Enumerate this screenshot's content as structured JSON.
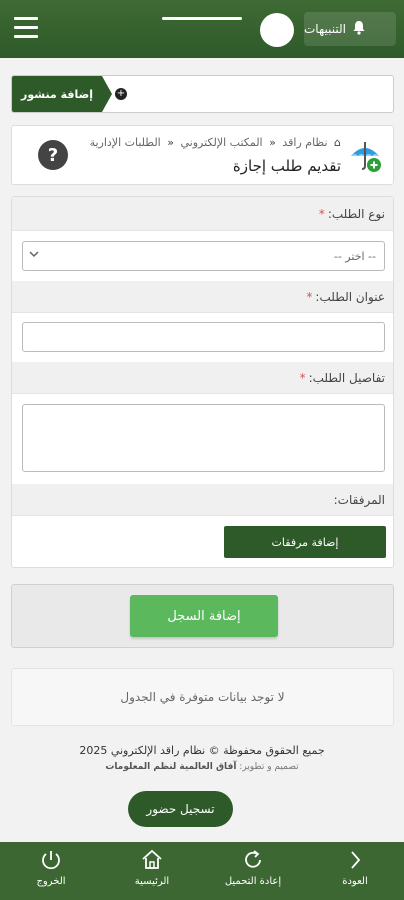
{
  "header": {
    "notifications_label": "التنبيهات"
  },
  "post_bar": {
    "add_post_label": "إضافة منشور"
  },
  "title_card": {
    "breadcrumb": [
      "نظام راقد",
      "المكتب الإلكتروني",
      "الطلبات الإدارية"
    ],
    "page_title": "تقديم طلب إجازة"
  },
  "form": {
    "request_type_label": "نوع الطلب:",
    "request_type_placeholder": "-- اختر --",
    "request_title_label": "عنوان الطلب:",
    "request_details_label": "تفاصيل الطلب:",
    "attachments_label": "المرفقات:",
    "add_attachments_button": "إضافة مرفقات",
    "required_mark": "*"
  },
  "submit": {
    "label": "إضافة السجل"
  },
  "table": {
    "empty_message": "لا توجد بيانات متوفرة في الجدول"
  },
  "footer": {
    "copyright": "جميع الحقوق محفوظة © نظام راقد الإلكتروني 2025",
    "design_prefix": "تصميم و تطوير:",
    "design_company": "آفاق العالمية لنظم المعلومات",
    "checkin_label": "تسجيل حضور"
  },
  "bottom_nav": {
    "logout": "الخروج",
    "home": "الرئيسية",
    "reload": "إعادة التحميل",
    "back": "العودة"
  },
  "colors": {
    "primary_green": "#2e5a2a",
    "submit_green": "#5cb85c",
    "required_red": "#d9534f"
  }
}
